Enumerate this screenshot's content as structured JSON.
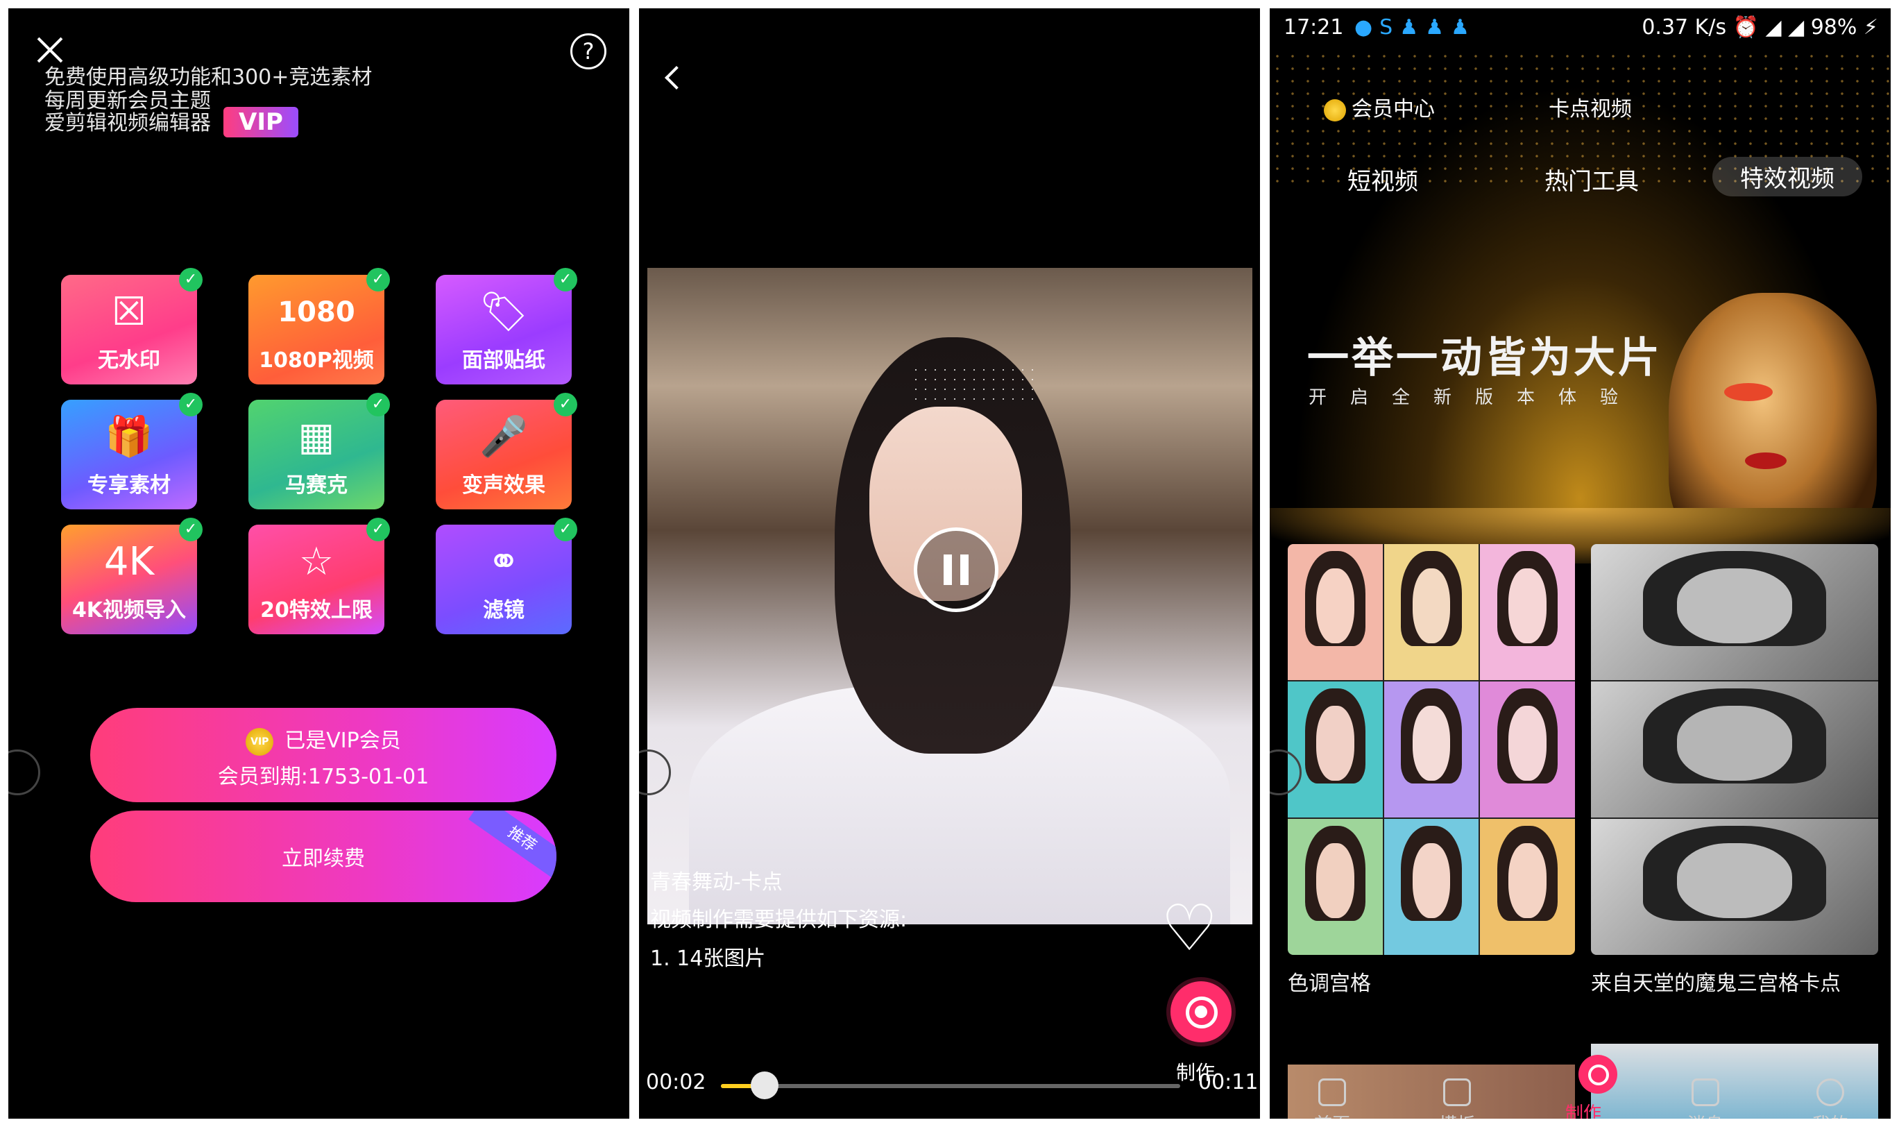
{
  "vip_screen": {
    "features": [
      "免费使用高级功能和300+竞选素材",
      "每周更新会员主题",
      "爱剪辑视频编辑器"
    ],
    "vip_badge": "VIP",
    "tiles": [
      {
        "icon": "no-watermark-icon",
        "glyph": "☒",
        "label": "无水印",
        "checked": true
      },
      {
        "icon": "1080p-icon",
        "glyph": "1080",
        "label": "1080P视频",
        "checked": true
      },
      {
        "icon": "face-sticker-icon",
        "glyph": "🏷",
        "label": "面部贴纸",
        "checked": true
      },
      {
        "icon": "gift-icon",
        "glyph": "🎁",
        "label": "专享素材",
        "checked": true
      },
      {
        "icon": "mosaic-icon",
        "glyph": "▦",
        "label": "马赛克",
        "checked": true
      },
      {
        "icon": "microphone-icon",
        "glyph": "🎤",
        "label": "变声效果",
        "checked": true
      },
      {
        "icon": "4k-icon",
        "glyph": "4K",
        "label": "4K视频导入",
        "checked": true
      },
      {
        "icon": "star-icon",
        "glyph": "☆",
        "label": "20特效上限",
        "checked": true
      },
      {
        "icon": "filter-icon",
        "glyph": "⚭",
        "label": "滤镜",
        "checked": true
      }
    ],
    "member_status": "已是VIP会员",
    "member_expiry": "会员到期:1753-01-01",
    "renew_label": "立即续费",
    "recommend_tag": "推荐",
    "medal_text": "VIP"
  },
  "player_screen": {
    "overlay_title": "青春舞动-卡点",
    "overlay_desc": "视频制作需要提供如下资源:",
    "overlay_req": "1. 14张图片",
    "make_label": "制作",
    "current_time": "00:02",
    "total_time": "00:11",
    "progress": 0.095
  },
  "home_screen": {
    "status": {
      "time": "17:21",
      "icons": "●S♟♟♟",
      "right": "0.37 K/s ⏰ ◢ ◢ 98% ⚡"
    },
    "nav_top": [
      "会员中心",
      "卡点视频"
    ],
    "nav_tabs": [
      "短视频",
      "热门工具",
      "特效视频"
    ],
    "active_tab": "特效视频",
    "slogan": "一举一动皆为大片",
    "slogan_sub": "开启全新版本体验",
    "cards": [
      "色调宫格",
      "来自天堂的魔鬼三宫格卡点"
    ],
    "tabbar": [
      "首页",
      "模板",
      "制作",
      "消息",
      "我的"
    ]
  },
  "colors": {
    "accent_pink": "#ff2d6b",
    "check_green": "#21c45f",
    "progress_yellow": "#ffcf1f"
  }
}
